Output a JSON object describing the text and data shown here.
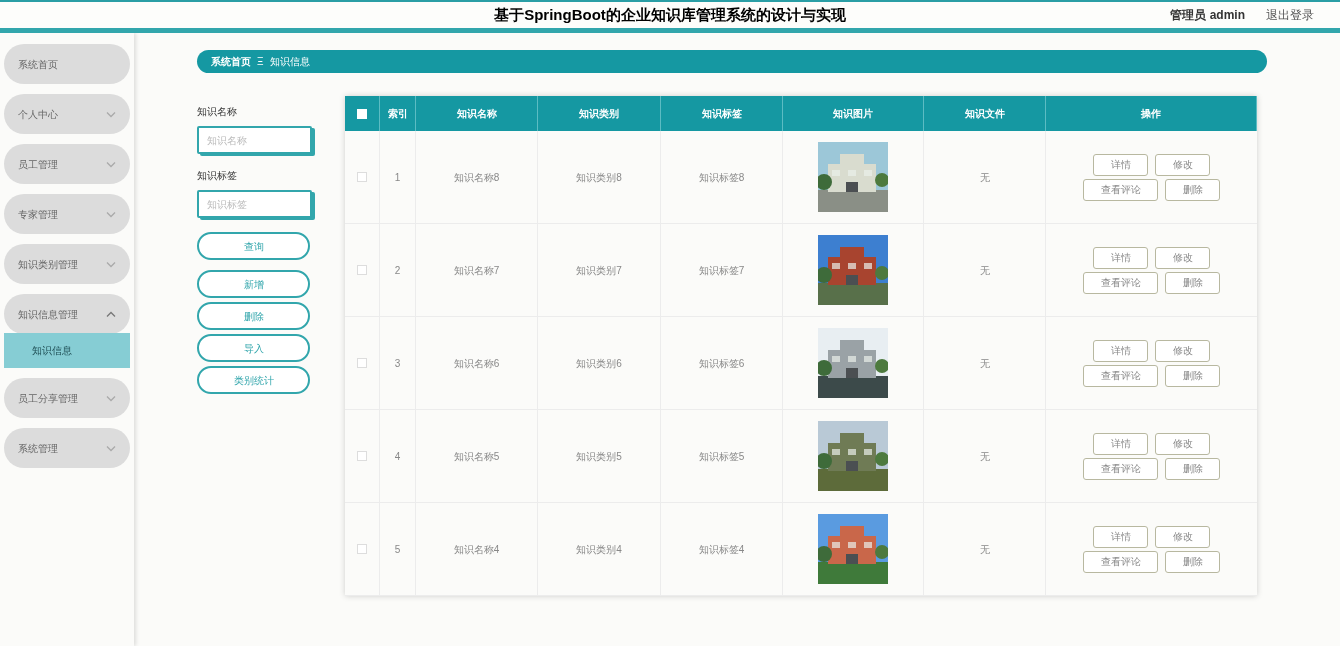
{
  "header": {
    "title": "基于SpringBoot的企业知识库管理系统的设计与实现",
    "user": "管理员 admin",
    "logout": "退出登录"
  },
  "sidebar": {
    "items": [
      {
        "label": "系统首页"
      },
      {
        "label": "个人中心",
        "expanded": false
      },
      {
        "label": "员工管理",
        "expanded": false
      },
      {
        "label": "专家管理",
        "expanded": false
      },
      {
        "label": "知识类别管理",
        "expanded": false
      },
      {
        "label": "知识信息管理",
        "expanded": true,
        "children": [
          {
            "label": "知识信息",
            "selected": true
          }
        ]
      },
      {
        "label": "员工分享管理",
        "expanded": false
      },
      {
        "label": "系统管理",
        "expanded": false
      }
    ]
  },
  "breadcrumb": {
    "home": "系统首页",
    "separator": "Ξ",
    "current": "知识信息"
  },
  "filters": [
    {
      "label": "知识名称",
      "placeholder": "知识名称"
    },
    {
      "label": "知识标签",
      "placeholder": "知识标签"
    }
  ],
  "search_button": "查询",
  "action_buttons": [
    "新增",
    "删除",
    "导入",
    "类别统计"
  ],
  "table": {
    "columns": [
      "索引",
      "知识名称",
      "知识类别",
      "知识标签",
      "知识图片",
      "知识文件",
      "操作"
    ],
    "all_checked": false,
    "rows": [
      {
        "checked": false,
        "index": "1",
        "name": "知识名称8",
        "category": "知识类别8",
        "tag": "知识标签8",
        "file": "无",
        "actions": [
          "详情",
          "修改",
          "查看评论",
          "删除"
        ],
        "picture": {
          "kind": "picture"
        }
      },
      {
        "checked": false,
        "index": "2",
        "name": "知识名称7",
        "category": "知识类别7",
        "tag": "知识标签7",
        "file": "无",
        "actions": [
          "详情",
          "修改",
          "查看评论",
          "删除"
        ],
        "picture": {
          "kind": "picture"
        }
      },
      {
        "checked": false,
        "index": "3",
        "name": "知识名称6",
        "category": "知识类别6",
        "tag": "知识标签6",
        "file": "无",
        "actions": [
          "详情",
          "修改",
          "查看评论",
          "删除"
        ],
        "picture": {
          "kind": "picture"
        }
      },
      {
        "checked": false,
        "index": "4",
        "name": "知识名称5",
        "category": "知识类别5",
        "tag": "知识标签5",
        "file": "无",
        "actions": [
          "详情",
          "修改",
          "查看评论",
          "删除"
        ],
        "picture": {
          "kind": "picture"
        }
      },
      {
        "checked": false,
        "index": "5",
        "name": "知识名称4",
        "category": "知识类别4",
        "tag": "知识标签4",
        "file": "无",
        "actions": [
          "详情",
          "修改",
          "查看评论",
          "删除"
        ],
        "picture": {
          "kind": "picture"
        }
      }
    ]
  }
}
